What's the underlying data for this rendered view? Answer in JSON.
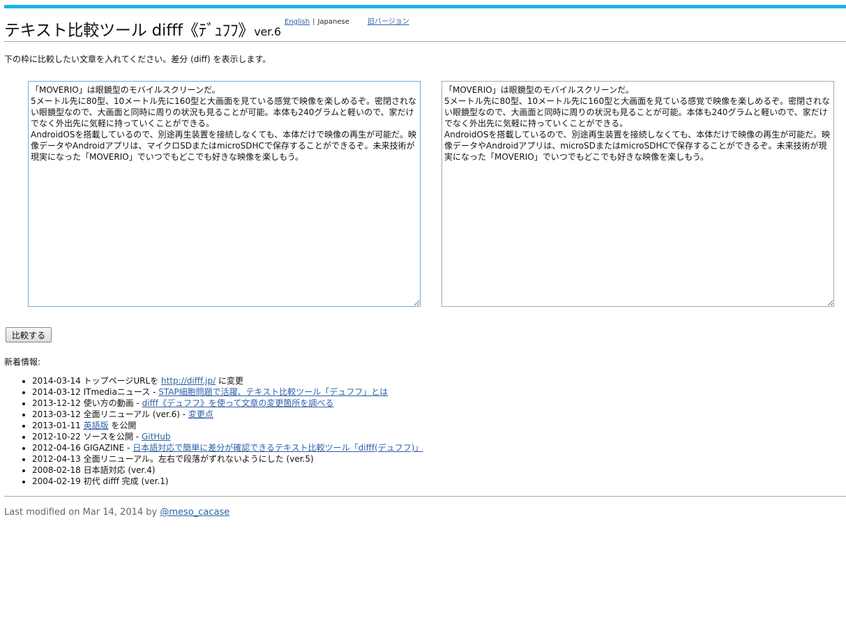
{
  "header": {
    "title": "テキスト比較ツール difff《ﾃﾞｭﾌﾌ》",
    "version": "ver.6",
    "lang_english": "English",
    "lang_sep": "|",
    "lang_japanese": "Japanese",
    "old_version": "旧バージョン",
    "accent_color": "#19b5e8"
  },
  "intro": "下の枠に比較したい文章を入れてください。差分 (diff) を表示します。",
  "left_text": "「MOVERIO」は眼鏡型のモバイルスクリーンだ。\n5メートル先に80型、10メートル先に160型と大画面を見ている感覚で映像を楽しめるぞ。密閉されない眼鏡型なので、大画面と同時に周りの状況も見ることが可能。本体も240グラムと軽いので、家だけでなく外出先に気軽に持っていくことができる。\nAndroidOSを搭載しているので、別途再生装置を接続しなくても、本体だけで映像の再生が可能だ。映像データやAndroidアプリは、マイクロSDまたはmicroSDHCで保存することができるぞ。未来技術が現実になった「MOVERIO」でいつでもどこでも好きな映像を楽しもう。",
  "right_text": "「MOVERIO」は眼鏡型のモバイルスクリーンだ。\n5メートル先に80型、10メートル先に160型と大画面を見ている感覚で映像を楽しめるぞ。密閉されない眼鏡型なので、大画面と同時に周りの状況も見ることが可能。本体も240グラムと軽いので、家だけでなく外出先に気軽に持っていくことができる。\nAndroidOSを搭載しているので、別途再生装置を接続しなくても、本体だけで映像の再生が可能だ。映像データやAndroidアプリは、microSDまたはmicroSDHCで保存することができるぞ。未来技術が現実になった「MOVERIO」でいつでもどこでも好きな映像を楽しもう。",
  "compare_button": "比較する",
  "news_heading": "新着情報:",
  "news": [
    {
      "date": "2014-03-14",
      "before": "トップページURLを",
      "link": "http://difff.jp/",
      "after": "に変更"
    },
    {
      "date": "2014-03-12",
      "before": "ITmediaニュース -",
      "link": "STAP細胞問題で活躍、テキスト比較ツール「デュフフ」とは",
      "after": ""
    },
    {
      "date": "2013-12-12",
      "before": "使い方の動画 -",
      "link": "difff《デュフフ》を使って文章の変更箇所を調べる",
      "after": ""
    },
    {
      "date": "2013-03-12",
      "before": "全面リニューアル (ver.6) -",
      "link": "変更点",
      "after": ""
    },
    {
      "date": "2013-01-11",
      "before": "",
      "link": "英語版",
      "after": "を公開"
    },
    {
      "date": "2012-10-22",
      "before": "ソースを公開 -",
      "link": "GitHub",
      "after": ""
    },
    {
      "date": "2012-04-16",
      "before": "GIGAZINE -",
      "link": "日本語対応で簡単に差分が確認できるテキスト比較ツール「difff(デュフフ)」",
      "after": ""
    },
    {
      "date": "2012-04-13",
      "before": "全面リニューアル。左右で段落がずれないようにした (ver.5)",
      "link": "",
      "after": ""
    },
    {
      "date": "2008-02-18",
      "before": "日本語対応 (ver.4)",
      "link": "",
      "after": ""
    },
    {
      "date": "2004-02-19",
      "before": "初代 difff 完成 (ver.1)",
      "link": "",
      "after": ""
    }
  ],
  "footer": {
    "text": "Last modified on Mar 14, 2014 by",
    "author": "@meso_cacase"
  }
}
